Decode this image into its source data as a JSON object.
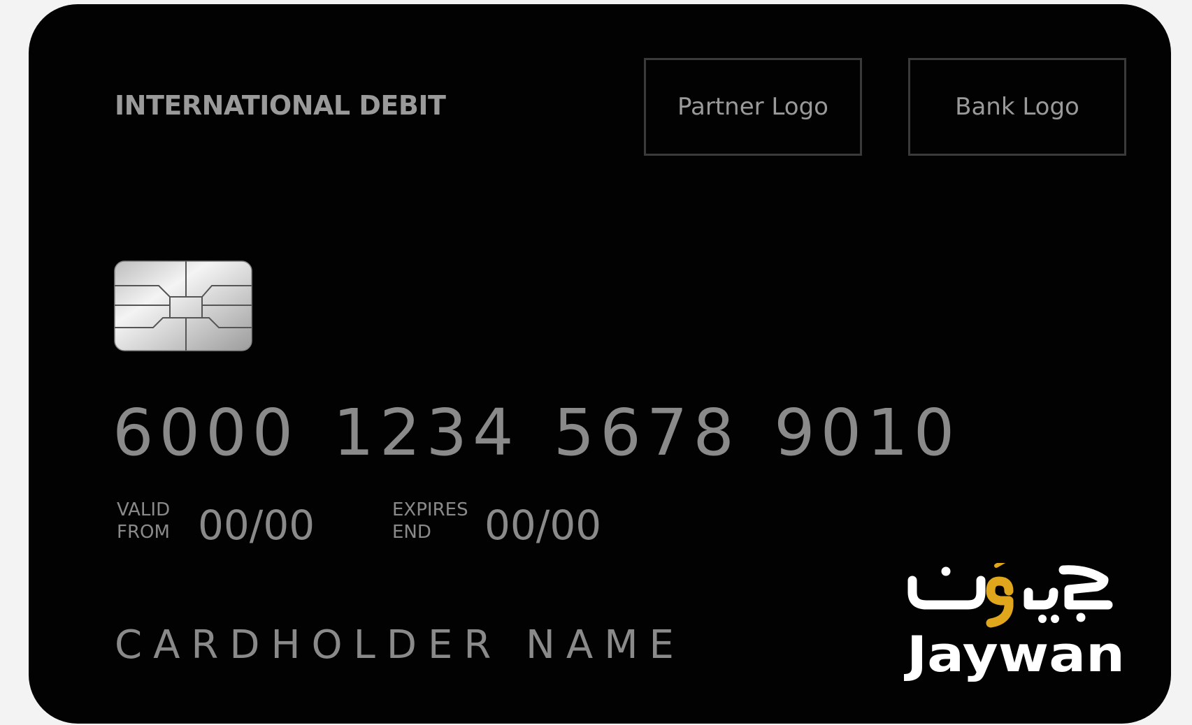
{
  "card": {
    "type_label": "INTERNATIONAL DEBIT",
    "partner_logo_text": "Partner Logo",
    "bank_logo_text": "Bank Logo",
    "number": "6000 1234 5678 9010",
    "valid_from": {
      "label_line1": "VALID",
      "label_line2": "FROM",
      "value": "00/00"
    },
    "expires_end": {
      "label_line1": "EXPIRES",
      "label_line2": "END",
      "value": "00/00"
    },
    "cardholder_name": "CARDHOLDER NAME",
    "network_logo": {
      "arabic_wordmark": "جيوَن",
      "latin_wordmark": "Jaywan",
      "accent_color": "#e0a71d",
      "text_color": "#ffffff"
    },
    "chip_icon": "emv-chip-icon"
  },
  "colors": {
    "card_background": "#020202",
    "page_background": "#f3f3f3",
    "text_gray": "#8a8a8a",
    "box_border": "#3a3a3a"
  }
}
